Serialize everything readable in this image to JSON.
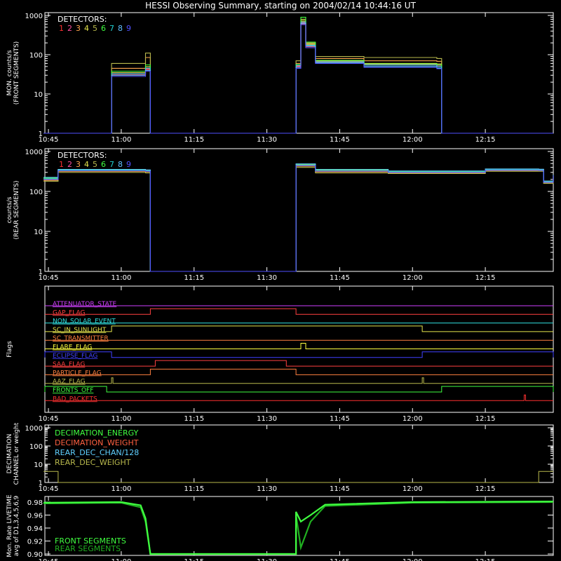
{
  "title": "HESSI Observing Summary, starting on 2004/02/14 10:44:16 UT",
  "colors": {
    "detectors": [
      "#ff3030",
      "#ff4fa0",
      "#ffa64d",
      "#e6e64d",
      "#b9b94d",
      "#40ff40",
      "#20d0d0",
      "#60c0ff",
      "#5050ff"
    ],
    "axes": "#ffffff",
    "background": "#000000"
  },
  "chart_data": [
    {
      "type": "line",
      "ylabel": "MON. counts/s\n(FRONT SEGMENTS)",
      "yscale": "log",
      "ylim": [
        1,
        1000
      ],
      "yticks": [
        "1",
        "10",
        "100",
        "1000"
      ],
      "xlim": [
        "10:44:16",
        "12:29:00"
      ],
      "xticks": [
        "10:45",
        "11:00",
        "11:15",
        "11:30",
        "11:45",
        "12:00",
        "12:15"
      ],
      "legend_title": "DETECTORS:",
      "legend_items": [
        "1",
        "2",
        "3",
        "4",
        "5",
        "6",
        "7",
        "8",
        "9"
      ],
      "legend_position": "top-left",
      "series": [
        {
          "name": "1",
          "x": [
            "10:44",
            "10:57",
            "10:58",
            "11:05",
            "11:06",
            "11:36",
            "11:36",
            "11:37",
            "11:38",
            "11:40",
            "11:50",
            "12:05",
            "12:06",
            "12:29"
          ],
          "y": [
            1,
            1,
            30,
            42,
            1,
            1,
            50,
            600,
            160,
            65,
            55,
            50,
            1,
            1
          ]
        },
        {
          "name": "2",
          "x": [
            "10:44",
            "10:57",
            "10:58",
            "11:05",
            "11:06",
            "11:36",
            "11:36",
            "11:37",
            "11:38",
            "11:40",
            "11:50",
            "12:05",
            "12:06",
            "12:29"
          ],
          "y": [
            1,
            1,
            32,
            44,
            1,
            1,
            52,
            650,
            170,
            68,
            56,
            52,
            1,
            1
          ]
        },
        {
          "name": "3",
          "x": [
            "10:44",
            "10:57",
            "10:58",
            "11:05",
            "11:06",
            "11:36",
            "11:36",
            "11:37",
            "11:38",
            "11:40",
            "11:50",
            "12:05",
            "12:06",
            "12:29"
          ],
          "y": [
            1,
            1,
            45,
            85,
            1,
            1,
            60,
            700,
            180,
            80,
            70,
            68,
            1,
            1
          ]
        },
        {
          "name": "4",
          "x": [
            "10:44",
            "10:57",
            "10:58",
            "11:05",
            "11:06",
            "11:36",
            "11:36",
            "11:37",
            "11:38",
            "11:40",
            "11:50",
            "12:05",
            "12:06",
            "12:29"
          ],
          "y": [
            1,
            1,
            35,
            50,
            1,
            1,
            55,
            750,
            190,
            70,
            60,
            58,
            1,
            1
          ]
        },
        {
          "name": "5",
          "x": [
            "10:44",
            "10:57",
            "10:58",
            "11:05",
            "11:06",
            "11:36",
            "11:36",
            "11:37",
            "11:38",
            "11:40",
            "11:50",
            "12:05",
            "12:06",
            "12:29"
          ],
          "y": [
            1,
            1,
            60,
            110,
            1,
            1,
            70,
            800,
            200,
            90,
            85,
            80,
            1,
            1
          ]
        },
        {
          "name": "6",
          "x": [
            "10:44",
            "10:57",
            "10:58",
            "11:05",
            "11:06",
            "11:36",
            "11:36",
            "11:37",
            "11:38",
            "11:40",
            "11:50",
            "12:05",
            "12:06",
            "12:29"
          ],
          "y": [
            1,
            1,
            38,
            55,
            1,
            1,
            56,
            900,
            210,
            72,
            58,
            55,
            1,
            1
          ]
        },
        {
          "name": "7",
          "x": [
            "10:44",
            "10:57",
            "10:58",
            "11:05",
            "11:06",
            "11:36",
            "11:36",
            "11:37",
            "11:38",
            "11:40",
            "11:50",
            "12:05",
            "12:06",
            "12:29"
          ],
          "y": [
            1,
            1,
            33,
            46,
            1,
            1,
            54,
            680,
            175,
            66,
            54,
            50,
            1,
            1
          ]
        },
        {
          "name": "8",
          "x": [
            "10:44",
            "10:57",
            "10:58",
            "11:05",
            "11:06",
            "11:36",
            "11:36",
            "11:37",
            "11:38",
            "11:40",
            "11:50",
            "12:05",
            "12:06",
            "12:29"
          ],
          "y": [
            1,
            1,
            30,
            40,
            1,
            1,
            48,
            620,
            165,
            62,
            50,
            46,
            1,
            1
          ]
        },
        {
          "name": "9",
          "x": [
            "10:44",
            "10:57",
            "10:58",
            "11:05",
            "11:06",
            "11:36",
            "11:36",
            "11:37",
            "11:38",
            "11:40",
            "11:50",
            "12:05",
            "12:06",
            "12:29"
          ],
          "y": [
            1,
            1,
            28,
            38,
            1,
            1,
            45,
            580,
            150,
            60,
            48,
            44,
            1,
            1
          ]
        }
      ]
    },
    {
      "type": "line",
      "ylabel": "counts/s\n(REAR SEGMENTS)",
      "yscale": "log",
      "ylim": [
        1,
        1000
      ],
      "yticks": [
        "1",
        "10",
        "100",
        "1000"
      ],
      "xlim": [
        "10:44:16",
        "12:29:00"
      ],
      "xticks": [
        "10:45",
        "11:00",
        "11:15",
        "11:30",
        "11:45",
        "12:00",
        "12:15"
      ],
      "legend_title": "DETECTORS:",
      "legend_items": [
        "1",
        "2",
        "3",
        "4",
        "5",
        "6",
        "7",
        "8",
        "9"
      ],
      "legend_position": "top-left",
      "series": [
        {
          "name": "1",
          "x": [
            "10:44",
            "10:46",
            "10:47",
            "11:05",
            "11:06",
            "11:36",
            "11:36",
            "11:40",
            "11:55",
            "12:15",
            "12:26",
            "12:27",
            "12:29"
          ],
          "y": [
            200,
            200,
            330,
            320,
            1,
            1,
            450,
            320,
            300,
            340,
            340,
            170,
            250
          ]
        },
        {
          "name": "2",
          "x": [
            "10:44",
            "10:46",
            "10:47",
            "11:05",
            "11:06",
            "11:36",
            "11:36",
            "11:40",
            "11:55",
            "12:15",
            "12:26",
            "12:27",
            "12:29"
          ],
          "y": [
            210,
            210,
            340,
            330,
            1,
            1,
            460,
            330,
            310,
            350,
            345,
            175,
            255
          ]
        },
        {
          "name": "3",
          "x": [
            "10:44",
            "10:46",
            "10:47",
            "11:05",
            "11:06",
            "11:36",
            "11:36",
            "11:40",
            "11:55",
            "12:15",
            "12:26",
            "12:27",
            "12:29"
          ],
          "y": [
            190,
            190,
            320,
            310,
            1,
            1,
            430,
            310,
            290,
            330,
            330,
            165,
            245
          ]
        },
        {
          "name": "4",
          "x": [
            "10:44",
            "10:46",
            "10:47",
            "11:05",
            "11:06",
            "11:36",
            "11:36",
            "11:40",
            "11:55",
            "12:15",
            "12:26",
            "12:27",
            "12:29"
          ],
          "y": [
            220,
            220,
            350,
            340,
            1,
            1,
            470,
            340,
            320,
            360,
            355,
            180,
            260
          ]
        },
        {
          "name": "5",
          "x": [
            "10:44",
            "10:46",
            "10:47",
            "11:05",
            "11:06",
            "11:36",
            "11:36",
            "11:40",
            "11:55",
            "12:15",
            "12:26",
            "12:27",
            "12:29"
          ],
          "y": [
            180,
            180,
            300,
            290,
            1,
            1,
            400,
            290,
            280,
            320,
            320,
            160,
            240
          ]
        },
        {
          "name": "6",
          "x": [
            "10:44",
            "10:46",
            "10:47",
            "11:05",
            "11:06",
            "11:36",
            "11:36",
            "11:40",
            "11:55",
            "12:15",
            "12:26",
            "12:27",
            "12:29"
          ],
          "y": [
            215,
            215,
            345,
            335,
            1,
            1,
            480,
            345,
            315,
            355,
            350,
            178,
            258
          ]
        },
        {
          "name": "7",
          "x": [
            "10:44",
            "10:46",
            "10:47",
            "11:05",
            "11:06",
            "11:36",
            "11:36",
            "11:40",
            "11:55",
            "12:15",
            "12:26",
            "12:27",
            "12:29"
          ],
          "y": [
            205,
            205,
            335,
            325,
            1,
            1,
            455,
            325,
            305,
            345,
            340,
            172,
            252
          ]
        },
        {
          "name": "8",
          "x": [
            "10:44",
            "10:46",
            "10:47",
            "11:05",
            "11:06",
            "11:36",
            "11:36",
            "11:40",
            "11:55",
            "12:15",
            "12:26",
            "12:27",
            "12:29"
          ],
          "y": [
            225,
            225,
            355,
            345,
            1,
            1,
            490,
            355,
            325,
            365,
            360,
            182,
            262
          ]
        },
        {
          "name": "9",
          "x": [
            "10:44",
            "10:46",
            "10:47",
            "11:05",
            "11:06",
            "11:36",
            "11:36",
            "11:40",
            "11:55",
            "12:15",
            "12:26",
            "12:27",
            "12:29"
          ],
          "y": [
            200,
            200,
            330,
            320,
            1,
            1,
            445,
            325,
            300,
            340,
            338,
            170,
            250
          ]
        }
      ]
    },
    {
      "type": "line",
      "ylabel": "Flags",
      "xlim": [
        "10:44:16",
        "12:29:00"
      ],
      "xticks": [
        "10:45",
        "11:00",
        "11:15",
        "11:30",
        "11:45",
        "12:00",
        "12:15"
      ],
      "flags": [
        {
          "label": "ATTENUATOR_STATE",
          "color": "#d040ff",
          "on": []
        },
        {
          "label": "GAP_FLAG",
          "color": "#ff4040",
          "on": [
            [
              "11:06",
              "11:36"
            ]
          ]
        },
        {
          "label": "NON_SOLAR_EVENT",
          "color": "#30e0e0",
          "on": []
        },
        {
          "label": "SC_IN_SUNLIGHT",
          "color": "#e6e64d",
          "on": [
            [
              "10:58",
              "12:02"
            ]
          ]
        },
        {
          "label": "SC_TRANSMITTER",
          "color": "#ff8040",
          "on": []
        },
        {
          "label": "FLARE_FLAG",
          "color": "#ffff40",
          "on": [
            [
              "11:37",
              "11:38"
            ]
          ]
        },
        {
          "label": "ECLIPSE_FLAG",
          "color": "#4040ff",
          "on": [
            [
              "10:44",
              "10:58"
            ],
            [
              "12:02",
              "12:29"
            ]
          ]
        },
        {
          "label": "SAA_FLAG",
          "color": "#ff4040",
          "on": [
            [
              "11:07",
              "11:34"
            ]
          ]
        },
        {
          "label": "PARTICLE_FLAG",
          "color": "#ff8040",
          "on": [
            [
              "11:06",
              "11:36"
            ]
          ]
        },
        {
          "label": "AAZ_FLAG",
          "color": "#b9b94d",
          "on": [
            [
              "10:58",
              "10:58"
            ],
            [
              "12:02",
              "12:02"
            ]
          ]
        },
        {
          "label": "FRONTS_OFF",
          "color": "#40ff40",
          "on": [
            [
              "10:44",
              "10:57"
            ],
            [
              "12:06",
              "12:29"
            ]
          ]
        },
        {
          "label": "BAD_PACKETS",
          "color": "#ff3030",
          "on": [
            [
              "12:23",
              "12:23"
            ]
          ]
        }
      ]
    },
    {
      "type": "line",
      "ylabel": "DECIMATION\nCHANNEL or weight",
      "yscale": "log",
      "ylim": [
        1,
        1000
      ],
      "yticks": [
        "1",
        "10",
        "100",
        "1000"
      ],
      "xlim": [
        "10:44:16",
        "12:29:00"
      ],
      "xticks": [
        "10:45",
        "11:00",
        "11:15",
        "11:30",
        "11:45",
        "12:00",
        "12:15"
      ],
      "legend_position": "top-left",
      "series": [
        {
          "name": "DECIMATION_ENERGY",
          "color": "#40ff40",
          "x": [],
          "y": []
        },
        {
          "name": "DECIMATION_WEIGHT",
          "color": "#ff6040",
          "x": [],
          "y": []
        },
        {
          "name": "REAR_DEC_CHAN/128",
          "color": "#60d0ff",
          "x": [],
          "y": []
        },
        {
          "name": "REAR_DEC_WEIGHT",
          "color": "#b9b94d",
          "x": [
            "10:44",
            "10:47",
            "10:47",
            "12:26",
            "12:26",
            "12:29"
          ],
          "y": [
            4,
            4,
            1,
            1,
            4,
            4
          ]
        }
      ]
    },
    {
      "type": "line",
      "ylabel": "Mon. Rate LIVETIME\navg of D1,3,4,5,6,9",
      "ylim": [
        0.9,
        0.98
      ],
      "yticks": [
        "0.90",
        "0.92",
        "0.94",
        "0.96",
        "0.98"
      ],
      "xlim": [
        "10:44:16",
        "12:29:00"
      ],
      "xticks": [
        "10:45",
        "11:00",
        "11:15",
        "11:30",
        "11:45",
        "12:00",
        "12:15"
      ],
      "legend_position": "bottom-left",
      "series": [
        {
          "name": "FRONT SEGMENTS",
          "color": "#40ff40",
          "x": [
            "10:44",
            "11:00",
            "11:04",
            "11:05",
            "11:06",
            "11:36",
            "11:36",
            "11:37",
            "11:39",
            "11:42",
            "12:00",
            "12:29"
          ],
          "y": [
            0.979,
            0.98,
            0.975,
            0.955,
            0.9,
            0.9,
            0.965,
            0.95,
            0.96,
            0.976,
            0.98,
            0.981
          ]
        },
        {
          "name": "REAR SEGMENTS",
          "color": "#20b020",
          "x": [
            "10:44",
            "11:00",
            "11:04",
            "11:05",
            "11:06",
            "11:36",
            "11:36",
            "11:37",
            "11:39",
            "11:42",
            "12:00",
            "12:29"
          ],
          "y": [
            0.978,
            0.979,
            0.972,
            0.95,
            0.9,
            0.9,
            0.96,
            0.91,
            0.95,
            0.974,
            0.979,
            0.98
          ]
        }
      ]
    }
  ]
}
